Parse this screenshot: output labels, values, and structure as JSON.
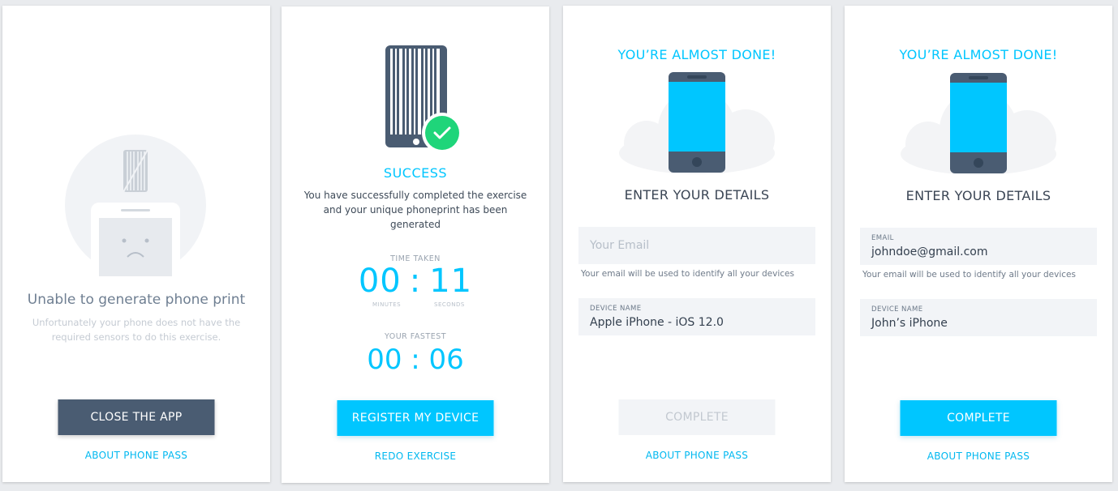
{
  "screens": {
    "error": {
      "title": "Unable to generate phone print",
      "message_line1": "Unfortunately your phone does not have the",
      "message_line2": "required sensors to do this exercise.",
      "close_button": "CLOSE THE APP",
      "about_link": "ABOUT PHONE PASS"
    },
    "success": {
      "heading": "SUCCESS",
      "message_line1": "You have successfully completed the exercise",
      "message_line2": "and your unique phoneprint has been",
      "message_line3": "generated",
      "time_taken_label": "TIME TAKEN",
      "time_minutes": "00",
      "time_separator": ":",
      "time_seconds": "11",
      "minutes_label": "MINUTES",
      "seconds_label": "SECONDS",
      "fastest_label": "YOUR FASTEST",
      "fastest_time": "00 : 06",
      "register_button": "REGISTER MY DEVICE",
      "redo_link": "REDO EXERCISE"
    },
    "details_empty": {
      "heading": "YOU’RE ALMOST DONE!",
      "subheading": "ENTER YOUR DETAILS",
      "email_placeholder": "Your Email",
      "email_hint": "Your email will be used to identify all your devices",
      "device_label": "DEVICE NAME",
      "device_value": "Apple iPhone - iOS 12.0",
      "complete_button": "COMPLETE",
      "about_link": "ABOUT PHONE PASS"
    },
    "details_filled": {
      "heading": "YOU’RE ALMOST DONE!",
      "subheading": "ENTER YOUR DETAILS",
      "email_label": "EMAIL",
      "email_value": "johndoe@gmail.com",
      "email_hint": "Your email will be used to identify all your devices",
      "device_label": "DEVICE NAME",
      "device_value": "John’s iPhone",
      "complete_button": "COMPLETE",
      "about_link": "ABOUT PHONE PASS"
    }
  },
  "colors": {
    "accent": "#00c6ff",
    "dark_button": "#4a5c72",
    "success_green": "#1fd57a",
    "phone_body": "#4a5c72",
    "phone_screen": "#00c6ff"
  },
  "icons": {
    "error_illustration": "sad-phone-icon",
    "success_illustration": "barcode-phone-icon",
    "check": "checkmark-icon",
    "details_illustration": "phone-cloud-icon"
  }
}
